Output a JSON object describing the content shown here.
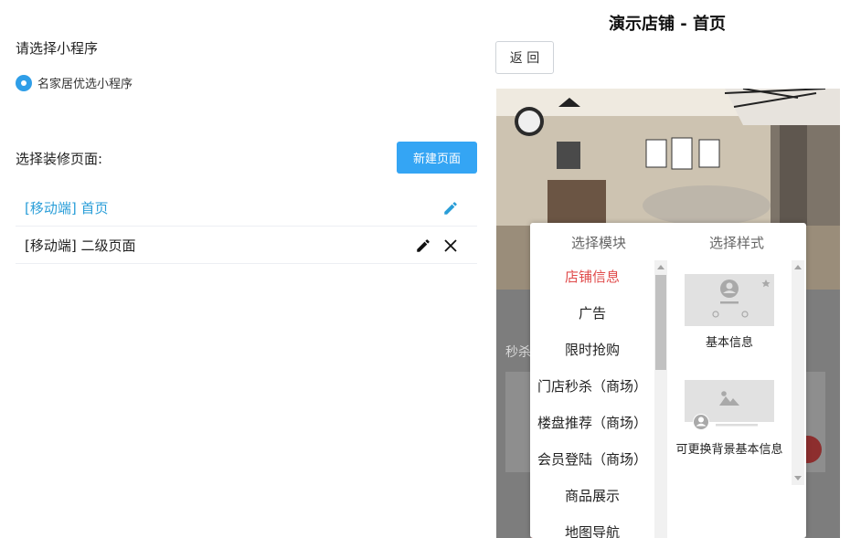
{
  "left": {
    "select_app_title": "请选择小程序",
    "app_option": "名家居优选小程序",
    "decor_title": "选择装修页面:",
    "new_page_button": "新建页面",
    "pages": [
      {
        "label": "[移动端] 首页"
      },
      {
        "label": "[移动端] 二级页面"
      }
    ]
  },
  "right": {
    "title": "演示店铺 - 首页",
    "back_button": "返 回",
    "behind_text": "秒杀"
  },
  "popup": {
    "module_header": "选择模块",
    "style_header": "选择样式",
    "modules": [
      "店铺信息",
      "广告",
      "限时抢购",
      "门店秒杀（商场）",
      "楼盘推荐（商场）",
      "会员登陆（商场）",
      "商品展示",
      "地图导航"
    ],
    "styles": [
      {
        "label": "基本信息"
      },
      {
        "label": "可更换背景基本信息"
      }
    ]
  },
  "colors": {
    "accent": "#34a5f4",
    "link": "#2a9ed8",
    "active_module": "#e04b4b"
  },
  "icons": [
    "radio-checked-icon",
    "pencil-icon",
    "close-icon",
    "user-icon",
    "image-icon"
  ]
}
